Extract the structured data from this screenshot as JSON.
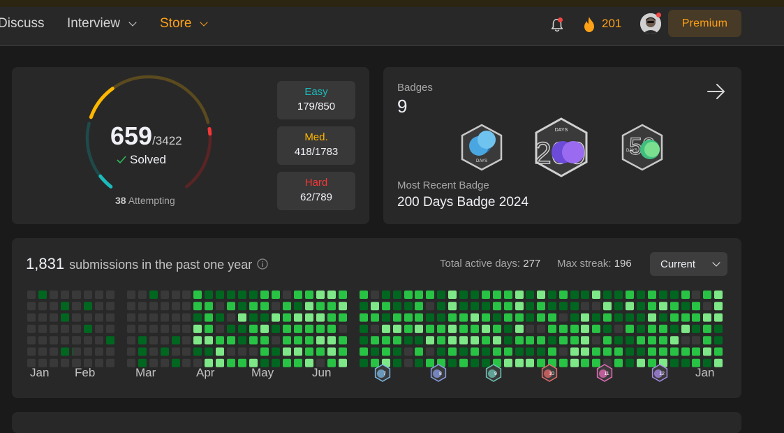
{
  "nav": {
    "discuss": "Discuss",
    "interview": "Interview",
    "store": "Store",
    "streak_count": "201",
    "premium": "Premium"
  },
  "progress": {
    "solved": "659",
    "total": "/3422",
    "solved_label": "Solved",
    "attempting_count": "38",
    "attempting_label": "Attempting",
    "difficulties": [
      {
        "label": "Easy",
        "value": "179/850",
        "color": "#1cbaba",
        "solved": 179,
        "total": 850
      },
      {
        "label": "Med.",
        "value": "418/1783",
        "color": "#ffb700",
        "solved": 418,
        "total": 1783
      },
      {
        "label": "Hard",
        "value": "62/789",
        "color": "#f63737",
        "solved": 62,
        "total": 789
      }
    ]
  },
  "badges": {
    "label": "Badges",
    "count": "9",
    "recent_label": "Most Recent Badge",
    "recent_name": "200 Days Badge 2024",
    "items": [
      {
        "icon": "days-badge-icon",
        "number": "",
        "days_text": "DAYS"
      },
      {
        "icon": "200-days-badge-icon",
        "number": "200",
        "days_text": "DAYS"
      },
      {
        "icon": "50-days-badge-icon",
        "number": "50",
        "days_text": "DAYS"
      }
    ]
  },
  "calendar": {
    "count": "1,831",
    "label": "submissions in the past one year",
    "active_label": "Total active days:",
    "active_value": "277",
    "streak_label": "Max streak:",
    "streak_value": "196",
    "select": "Current",
    "months": [
      "Jan",
      "Feb",
      "Mar",
      "Apr",
      "May",
      "Jun",
      "Jan"
    ],
    "monthly_badges": [
      {
        "number": "7",
        "color": "#7ab8e6"
      },
      {
        "number": "8",
        "color": "#8a9ee8"
      },
      {
        "number": "9",
        "color": "#6ec5b5"
      },
      {
        "number": "10",
        "color": "#e86a6a"
      },
      {
        "number": "11",
        "color": "#e86ab8"
      },
      {
        "number": "12",
        "color": "#a88ae8"
      }
    ],
    "colors": [
      "#393939",
      "#016620",
      "#28c244",
      "#7ee787"
    ]
  },
  "colors": {
    "accent": "#ffa116",
    "easy": "#1cbaba",
    "medium": "#ffb700",
    "hard": "#f63737"
  }
}
